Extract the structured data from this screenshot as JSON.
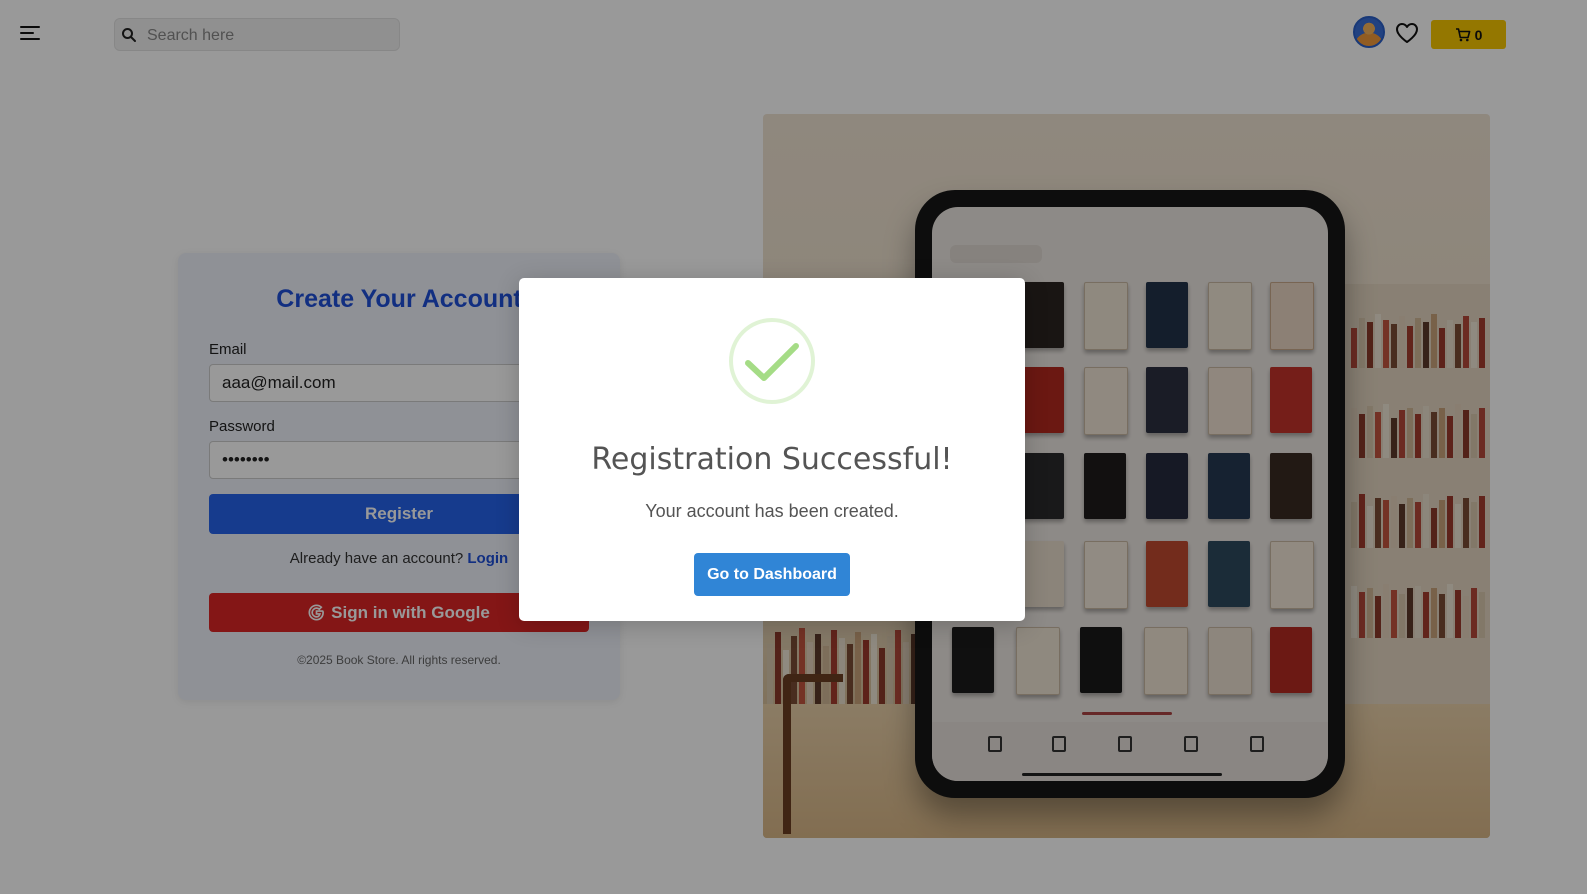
{
  "header": {
    "search_placeholder": "Search here",
    "cart_count": "0",
    "icons": {
      "menu": "hamburger-menu-icon",
      "search": "search-icon",
      "wishlist": "heart-icon",
      "cart": "cart-icon",
      "profile": "avatar"
    }
  },
  "register_form": {
    "title": "Create Your Account",
    "email_label": "Email",
    "email_value": "aaa@mail.com",
    "password_label": "Password",
    "password_value": "12345678",
    "register_label": "Register",
    "login_prompt": "Already have an account?",
    "login_link": "Login",
    "google_label": "Sign in with Google",
    "footer": "©2025 Book Store. All rights reserved."
  },
  "modal": {
    "title": "Registration Successful!",
    "text": "Your account has been created.",
    "button_label": "Go to Dashboard",
    "icon": "success-check-icon"
  },
  "colors": {
    "primary": "#2563eb",
    "title_blue": "#1e4fd8",
    "google_red": "#dc2626",
    "cart_yellow": "#f7c600",
    "modal_button": "#3085d6",
    "success_green": "#a5dc86"
  }
}
